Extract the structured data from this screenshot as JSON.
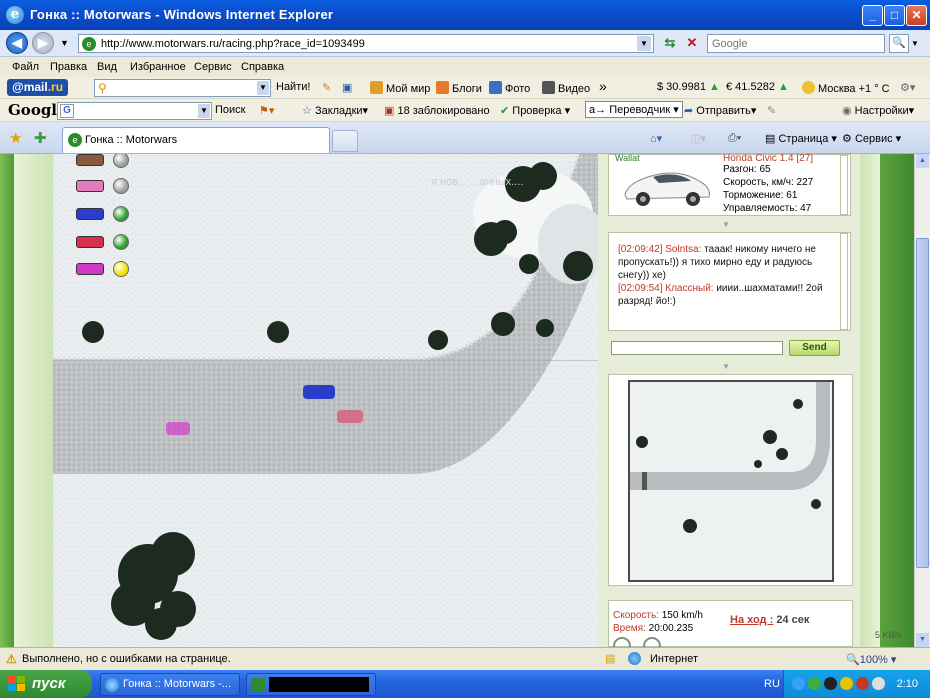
{
  "window": {
    "title": "Гонка :: Motorwars - Windows Internet Explorer",
    "logo": "e"
  },
  "address": {
    "url": "http://www.motorwars.ru/racing.php?race_id=1093499",
    "search_placeholder": "Google"
  },
  "menu": [
    "Файл",
    "Правка",
    "Вид",
    "Избранное",
    "Сервис",
    "Справка"
  ],
  "mailru": {
    "logo_at": "@mail",
    "logo_ru": ".ru",
    "find": "Найти!",
    "items": [
      "Мой мир",
      "Блоги",
      "Фото",
      "Видео"
    ],
    "more": "»",
    "usd": "$ 30.9981",
    "eur": "€ 41.5282",
    "weather": "Москва +1 ° С"
  },
  "google": {
    "logo": "Google",
    "search_label": "Поиск",
    "bookmarks": "Закладки",
    "blocked": "18 заблокировано",
    "check": "Проверка",
    "translator": "Переводчик",
    "send": "Отправить",
    "settings": "Настройки"
  },
  "tabs": {
    "active": "Гонка :: Motorwars",
    "page_menu": "Страница",
    "service_menu": "Сервис"
  },
  "game": {
    "overlay_text": "я нов... ...анных....",
    "car_colors": [
      "#8b5a3c",
      "#e37bbf",
      "#2a3fc9",
      "#d6304a",
      "#d23ac6"
    ],
    "light_colors": [
      "#9e9e9e",
      "#9e9e9e",
      "#2f9c2f",
      "#2f9c2f",
      "#f2e200"
    ]
  },
  "car_panel": {
    "name": "Honda Civic 1.4 [27]",
    "user": "Wallat",
    "stats": [
      {
        "label": "Разгон:",
        "value": "65"
      },
      {
        "label": "Скорость, км/ч:",
        "value": "227"
      },
      {
        "label": "Торможение:",
        "value": "61"
      },
      {
        "label": "Управляемость:",
        "value": "47"
      }
    ]
  },
  "chat": {
    "messages": [
      {
        "time": "[02:09:42]",
        "nick": "Solntsa:",
        "text": "тааак! никому ничего не пропускать!)) я тихо мирно еду и радуюсь снегу)) хе)"
      },
      {
        "time": "[02:09:54]",
        "nick": "Классный:",
        "text": "ииии..шахматами!! 2ой разряд! йо!:)"
      }
    ],
    "send_label": "Send"
  },
  "race_stats": {
    "speed_label": "Скорость:",
    "speed_value": "150 km/h",
    "time_label": "Время:",
    "time_value": "20:00.235",
    "turn_label": "На ход :",
    "turn_value": "24 сек"
  },
  "status": {
    "message": "Выполнено, но с ошибками на странице.",
    "zone": "Интернет",
    "zoom": "100%",
    "net_speed": "5 KB/s"
  },
  "taskbar": {
    "start": "пуск",
    "ie_task": "Гонка :: Motorwars -...",
    "lang": "RU",
    "clock": "2:10"
  }
}
